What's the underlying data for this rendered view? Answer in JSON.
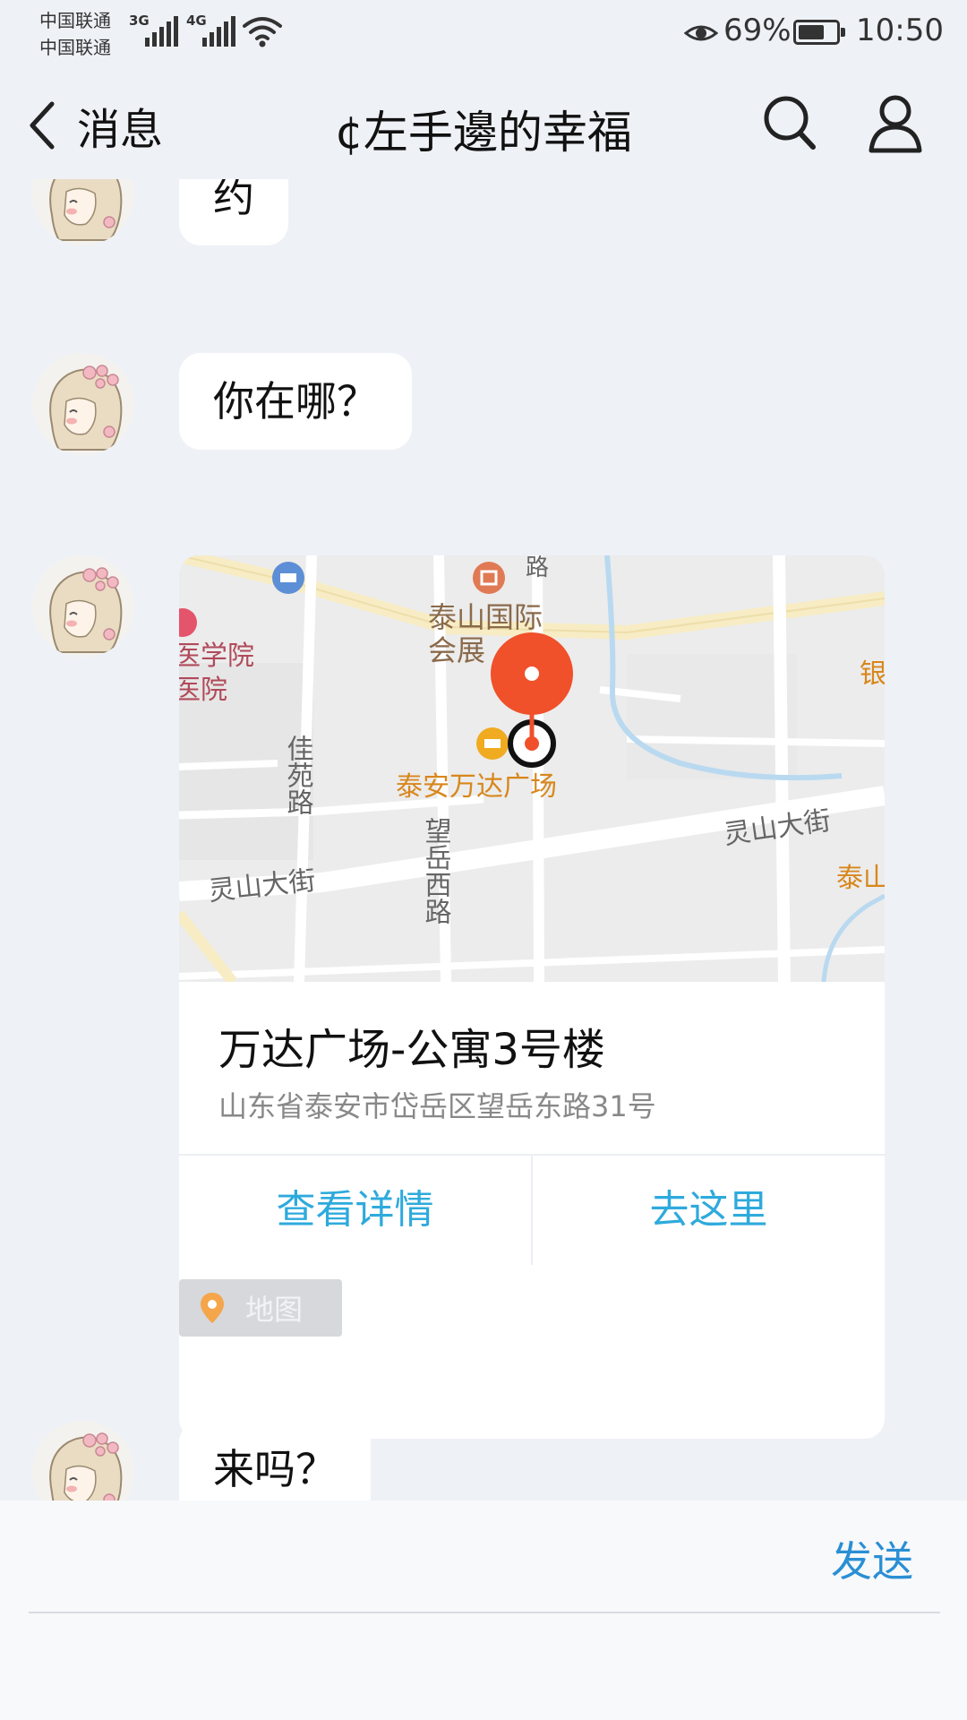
{
  "status_bar": {
    "carrier_1": "中国联通",
    "carrier_2": "中国联通",
    "network_1": "3G",
    "network_2": "4G",
    "battery_percent": "69%",
    "battery_level": 0.69,
    "time": "10:50"
  },
  "nav": {
    "back_label": "消息",
    "title": "¢左手邊的幸福",
    "icons": [
      "search-icon",
      "profile-icon"
    ]
  },
  "messages": [
    {
      "type": "text",
      "text": "约"
    },
    {
      "type": "text",
      "text": "你在哪？"
    },
    {
      "type": "location",
      "map": {
        "labels": {
          "exhibition_line1": "泰山国际",
          "exhibition_line2": "会展",
          "college_line1": "医学院",
          "college_line2": "医院",
          "wanda": "泰安万达广场",
          "jiayuan_road": "佳苑路",
          "wangyue_west_road": "望岳西路",
          "lingshan_street_left": "灵山大街",
          "lingshan_street_right": "灵山大街",
          "road_top": "路",
          "bank_edge": "银",
          "taishan_edge": "泰山"
        }
      },
      "place_name": "万达广场-公寓3号楼",
      "address": "山东省泰安市岱岳区望岳东路31号",
      "actions": {
        "details": "查看详情",
        "navigate": "去这里"
      },
      "tag": {
        "icon": "location-pin-icon",
        "label": "地图"
      }
    },
    {
      "type": "text",
      "text": "来吗？"
    }
  ],
  "input_bar": {
    "send_label": "发送"
  },
  "colors": {
    "background": "#eef1f6",
    "bubble": "#ffffff",
    "action_blue": "#2eaadc",
    "send_blue": "#2a8fd4",
    "pin_red": "#f0502a",
    "map_poi_orange": "#d8871c"
  }
}
